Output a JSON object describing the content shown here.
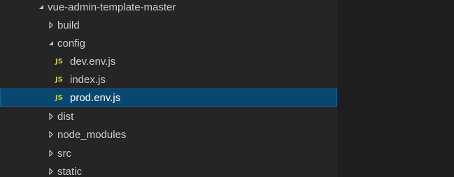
{
  "explorer": {
    "items": [
      {
        "label": "vue-admin-template-master",
        "type": "folder",
        "expanded": true
      },
      {
        "label": "build",
        "type": "folder",
        "expanded": false
      },
      {
        "label": "config",
        "type": "folder",
        "expanded": true
      },
      {
        "label": "dev.env.js",
        "type": "file",
        "icon_text": "JS"
      },
      {
        "label": "index.js",
        "type": "file",
        "icon_text": "JS"
      },
      {
        "label": "prod.env.js",
        "type": "file",
        "icon_text": "JS",
        "selected": true
      },
      {
        "label": "dist",
        "type": "folder",
        "expanded": false
      },
      {
        "label": "node_modules",
        "type": "folder",
        "expanded": false
      },
      {
        "label": "src",
        "type": "folder",
        "expanded": false
      },
      {
        "label": "static",
        "type": "folder",
        "expanded": false
      }
    ]
  },
  "colors": {
    "sidebar_background": "#252526",
    "editor_background": "#1e1e1e",
    "selection_background": "#094771",
    "text": "#cccccc",
    "js_icon": "#cbcb41"
  }
}
